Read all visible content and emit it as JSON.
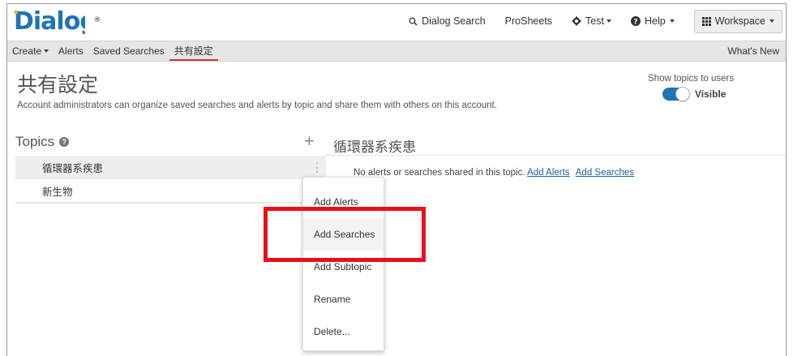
{
  "app": {
    "logo": "Dialog",
    "logo_mark": "®"
  },
  "topnav": {
    "search_label": "Dialog Search",
    "prosheets_label": "ProSheets",
    "test_label": "Test",
    "help_label": "Help",
    "workspace_label": "Workspace"
  },
  "subnav": {
    "tabs": [
      {
        "label": "Create",
        "dropdown": true
      },
      {
        "label": "Alerts"
      },
      {
        "label": "Saved Searches"
      },
      {
        "label": "共有設定",
        "active": true
      }
    ],
    "whats_new": "What's New"
  },
  "page": {
    "title": "共有設定",
    "description": "Account administrators can organize saved searches and alerts by topic and share them with others on this account.",
    "show_topics_label": "Show topics to users",
    "visibility_label": "Visible",
    "visibility_on": true
  },
  "topics": {
    "heading": "Topics",
    "add_symbol": "+",
    "items": [
      {
        "label": "循環器系疾患",
        "selected": true
      },
      {
        "label": "新生物"
      }
    ]
  },
  "detail": {
    "title": "循環器系疾患",
    "empty_message": "No alerts or searches shared in this topic.",
    "add_alerts_link": "Add Alerts",
    "add_searches_link": "Add Searches"
  },
  "context_menu": {
    "items": [
      {
        "label": "Add Alerts"
      },
      {
        "label": "Add Searches"
      },
      {
        "label": "Add Subtopic"
      },
      {
        "label": "Rename"
      },
      {
        "label": "Delete..."
      }
    ]
  },
  "colors": {
    "accent_red": "#e8101a",
    "toggle_blue": "#1f73b7",
    "link_blue": "#1f5ea8"
  }
}
